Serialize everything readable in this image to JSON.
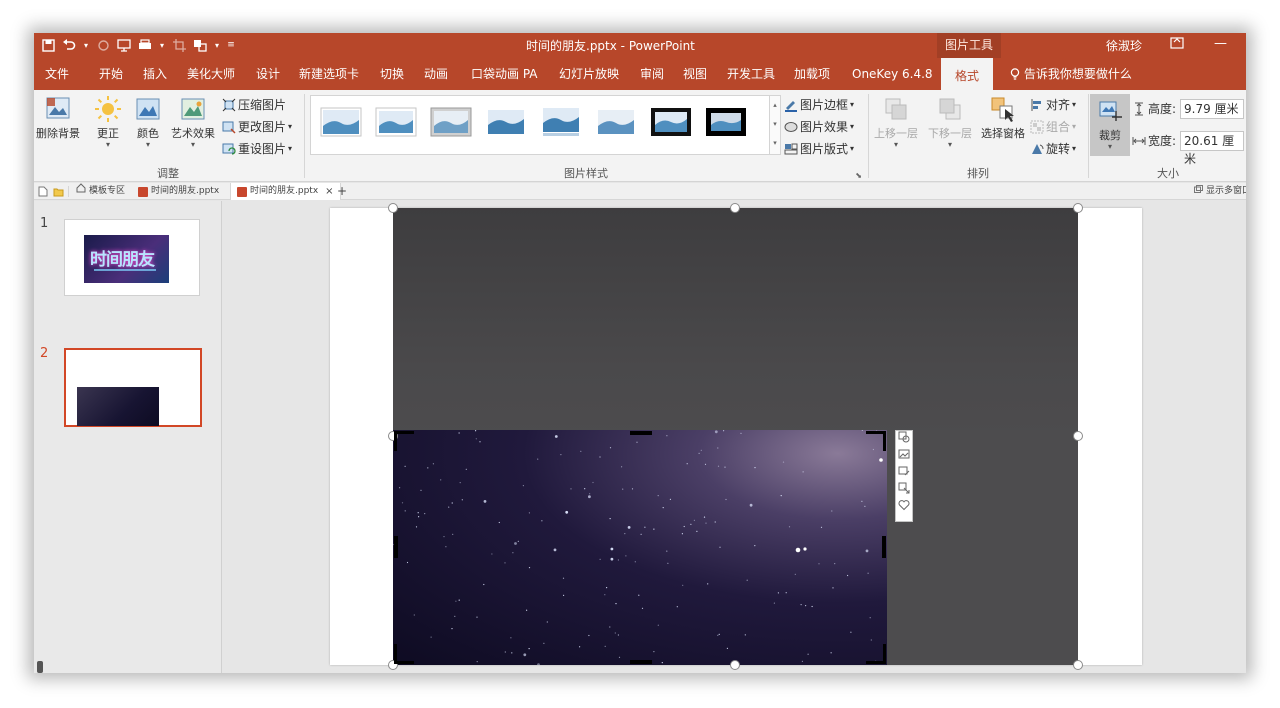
{
  "colors": {
    "accent": "#b7472a",
    "selection": "#d24726",
    "ribbon_bg": "#f3f3f3"
  },
  "titlebar": {
    "doc_title": "时间的朋友.pptx  -  PowerPoint",
    "context_tab_group": "图片工具",
    "user": "徐淑珍",
    "quick_access_icons": [
      "save-icon",
      "undo-icon",
      "redo-icon",
      "present-icon",
      "print-icon",
      "crop-icon",
      "arrange-icon",
      "customize-icon"
    ]
  },
  "tabs": [
    {
      "label": "文件"
    },
    {
      "label": "开始"
    },
    {
      "label": "插入"
    },
    {
      "label": "美化大师"
    },
    {
      "label": "设计"
    },
    {
      "label": "新建选项卡"
    },
    {
      "label": "切换"
    },
    {
      "label": "动画"
    },
    {
      "label": "口袋动画 PA"
    },
    {
      "label": "幻灯片放映"
    },
    {
      "label": "审阅"
    },
    {
      "label": "视图"
    },
    {
      "label": "开发工具"
    },
    {
      "label": "加载项"
    },
    {
      "label": "OneKey 6.4.8"
    },
    {
      "label": "格式",
      "active": true
    }
  ],
  "tell_me": "告诉我你想要做什么",
  "ribbon": {
    "adjust": {
      "label": "调整",
      "remove_bg": "删除背景",
      "corrections": "更正",
      "color": "颜色",
      "artistic": "艺术效果",
      "compress": "压缩图片",
      "change": "更改图片",
      "reset": "重设图片"
    },
    "styles": {
      "label": "图片样式",
      "border": "图片边框",
      "effects": "图片效果",
      "layout": "图片版式",
      "style_count": 8
    },
    "arrange": {
      "label": "排列",
      "forward": "上移一层",
      "backward": "下移一层",
      "selection_pane": "选择窗格",
      "align": "对齐",
      "group": "组合",
      "rotate": "旋转"
    },
    "size": {
      "label": "大小",
      "crop": "裁剪",
      "height_label": "高度:",
      "height_value": "9.79 厘米",
      "width_label": "宽度:",
      "width_value": "20.61 厘米"
    }
  },
  "doc_tabs": [
    {
      "label": "模板专区"
    },
    {
      "label": "时间的朋友.pptx"
    },
    {
      "label": "时间的朋友.pptx",
      "active": true
    }
  ],
  "doc_tabs_right": "显示多窗口",
  "slides": [
    {
      "num": "1",
      "thumb_text": "时间朋友"
    },
    {
      "num": "2",
      "selected": true
    }
  ],
  "float_toolbar_icons": [
    "layout-options-icon",
    "picture-replace-icon",
    "picture-edit-icon",
    "crop-resize-icon",
    "favorite-icon"
  ]
}
